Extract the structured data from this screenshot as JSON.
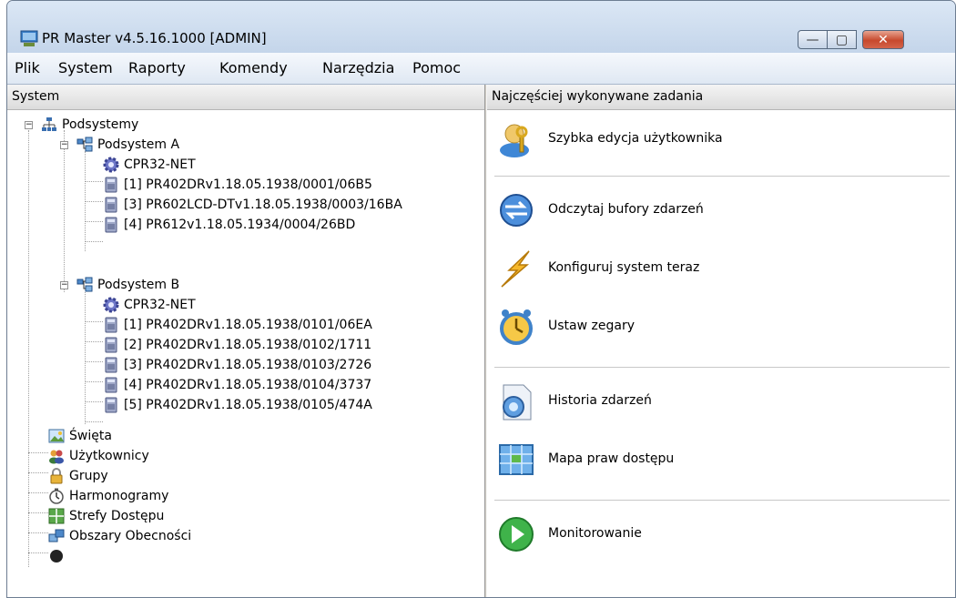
{
  "window": {
    "title": "PR Master v4.5.16.1000 [ADMIN]",
    "minimize_glyph": "—",
    "maximize_glyph": "▢",
    "close_glyph": "✕"
  },
  "menu": [
    "Plik",
    "System",
    "Raporty",
    "Komendy",
    "Narzędzia",
    "Pomoc"
  ],
  "left_panel": {
    "header": "System"
  },
  "right_panel": {
    "header": "Najczęściej wykonywane zadania"
  },
  "tree": {
    "root": "Podsystemy",
    "subsystem_a": {
      "label": "Podsystem A",
      "children": [
        "CPR32-NET",
        "[1] PR402DRv1.18.05.1938/0001/06B5",
        "[3] PR602LCD-DTv1.18.05.1938/0003/16BA",
        "[4] PR612v1.18.05.1934/0004/26BD"
      ]
    },
    "subsystem_b": {
      "label": "Podsystem B",
      "children": [
        "CPR32-NET",
        "[1] PR402DRv1.18.05.1938/0101/06EA",
        "[2] PR402DRv1.18.05.1938/0102/1711",
        "[3] PR402DRv1.18.05.1938/0103/2726",
        "[4] PR402DRv1.18.05.1938/0104/3737",
        "[5] PR402DRv1.18.05.1938/0105/474A"
      ]
    },
    "top_items": [
      "Święta",
      "Użytkownicy",
      "Grupy",
      "Harmonogramy",
      "Strefy Dostępu",
      "Obszary Obecności"
    ]
  },
  "tasks": [
    {
      "label": "Szybka edycja użytkownika",
      "icon": "user-key-icon"
    },
    {
      "label": "Odczytaj bufory zdarzeń",
      "icon": "read-buffer-icon"
    },
    {
      "label": "Konfiguruj system teraz",
      "icon": "lightning-icon"
    },
    {
      "label": "Ustaw zegary",
      "icon": "alarm-clock-icon"
    },
    {
      "label": "Historia zdarzeń",
      "icon": "history-icon"
    },
    {
      "label": "Mapa praw dostępu",
      "icon": "access-map-icon"
    },
    {
      "label": "Monitorowanie",
      "icon": "monitoring-play-icon"
    }
  ],
  "colors": {
    "accent": "#3d6fb6",
    "close_button": "#c7492d",
    "title_bar": "#c4d5ea"
  }
}
